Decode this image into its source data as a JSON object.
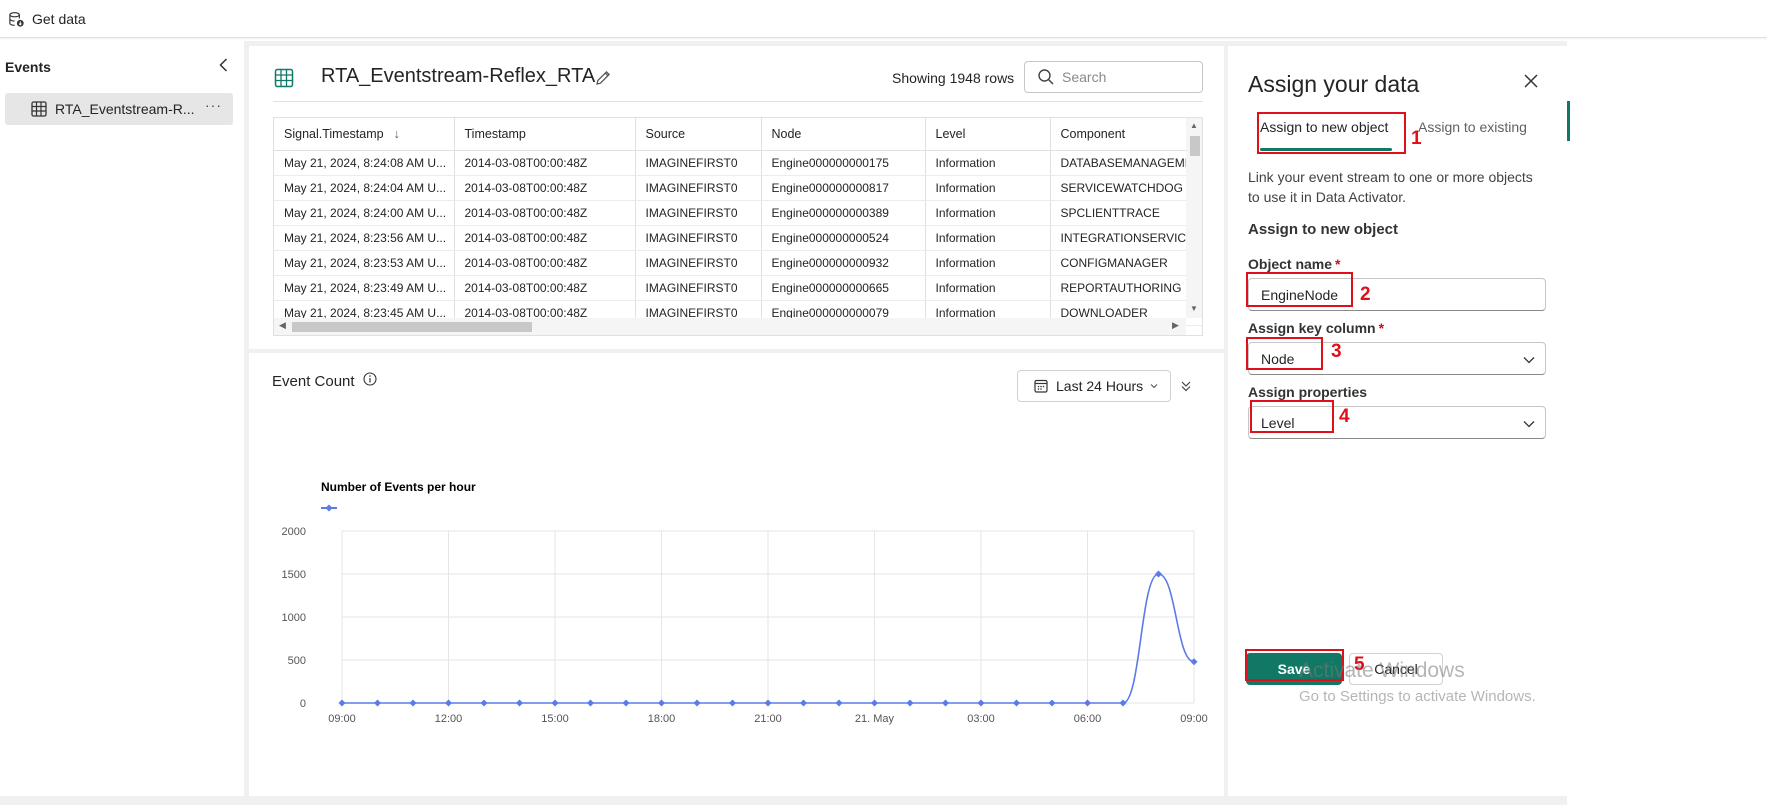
{
  "topbar": {
    "get_data_label": "Get data"
  },
  "left_panel": {
    "header": "Events",
    "items": [
      {
        "label": "RTA_Eventstream-R...",
        "more": "···"
      }
    ]
  },
  "center": {
    "title": "RTA_Eventstream-Reflex_RTA",
    "row_count": "Showing 1948 rows",
    "search_placeholder": "Search",
    "table": {
      "columns": [
        "Signal.Timestamp",
        "Timestamp",
        "Source",
        "Node",
        "Level",
        "Component"
      ],
      "sort_indicator": "↓",
      "rows": [
        [
          "May 21, 2024, 8:24:08 AM U...",
          "2014-03-08T00:00:48Z",
          "IMAGINEFIRST0",
          "Engine000000000175",
          "Information",
          "DATABASEMANAGEMENT"
        ],
        [
          "May 21, 2024, 8:24:04 AM U...",
          "2014-03-08T00:00:48Z",
          "IMAGINEFIRST0",
          "Engine000000000817",
          "Information",
          "SERVICEWATCHDOG"
        ],
        [
          "May 21, 2024, 8:24:00 AM U...",
          "2014-03-08T00:00:48Z",
          "IMAGINEFIRST0",
          "Engine000000000389",
          "Information",
          "SPCLIENTTRACE"
        ],
        [
          "May 21, 2024, 8:23:56 AM U...",
          "2014-03-08T00:00:48Z",
          "IMAGINEFIRST0",
          "Engine000000000524",
          "Information",
          "INTEGRATIONSERVICEF"
        ],
        [
          "May 21, 2024, 8:23:53 AM U...",
          "2014-03-08T00:00:48Z",
          "IMAGINEFIRST0",
          "Engine000000000932",
          "Information",
          "CONFIGMANAGER"
        ],
        [
          "May 21, 2024, 8:23:49 AM U...",
          "2014-03-08T00:00:48Z",
          "IMAGINEFIRST0",
          "Engine000000000665",
          "Information",
          "REPORTAUTHORING"
        ],
        [
          "May 21, 2024, 8:23:45 AM U...",
          "2014-03-08T00:00:48Z",
          "IMAGINEFIRST0",
          "Engine000000000079",
          "Information",
          "DOWNLOADER"
        ]
      ]
    },
    "event_count_title": "Event Count",
    "time_range": "Last 24 Hours"
  },
  "chart_data": {
    "type": "line",
    "title": "Number of Events per hour",
    "xlabel": "",
    "ylabel": "",
    "ylim": [
      0,
      2000
    ],
    "yticks": [
      0,
      500,
      1000,
      1500,
      2000
    ],
    "xticks": [
      "09:00",
      "12:00",
      "15:00",
      "18:00",
      "21:00",
      "21. May",
      "03:00",
      "06:00",
      "09:00"
    ],
    "series_color": "#5b7be9",
    "x": [
      "09:00",
      "10:00",
      "11:00",
      "12:00",
      "13:00",
      "14:00",
      "15:00",
      "16:00",
      "17:00",
      "18:00",
      "19:00",
      "20:00",
      "21:00",
      "22:00",
      "23:00",
      "00:00",
      "01:00",
      "02:00",
      "03:00",
      "04:00",
      "05:00",
      "06:00",
      "07:00",
      "08:00",
      "09:00"
    ],
    "series": [
      {
        "values": [
          0,
          0,
          0,
          0,
          0,
          0,
          0,
          0,
          0,
          0,
          0,
          0,
          0,
          0,
          0,
          0,
          0,
          0,
          0,
          0,
          0,
          0,
          0,
          1500,
          480
        ]
      }
    ]
  },
  "right_panel": {
    "title": "Assign your data",
    "tab_new": "Assign to new object",
    "tab_existing": "Assign to existing",
    "description": "Link your event stream to one or more objects to use it in Data Activator.",
    "section_title": "Assign to new object",
    "object_name_label": "Object name",
    "object_name_value": "EngineNode",
    "key_column_label": "Assign key column",
    "key_column_value": "Node",
    "properties_label": "Assign properties",
    "properties_value": "Level",
    "required_mark": "*",
    "save_label": "Save",
    "cancel_label": "Cancel"
  },
  "annotations": [
    "1",
    "2",
    "3",
    "4",
    "5"
  ],
  "watermark": {
    "line1": "Activate Windows",
    "line2": "Go to Settings to activate Windows."
  },
  "colors": {
    "accent": "#117865",
    "callout": "#e0101a",
    "chart_line": "#5b7be9"
  }
}
